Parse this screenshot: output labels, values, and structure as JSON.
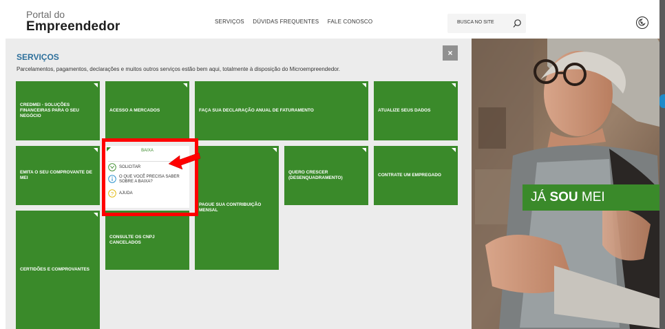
{
  "header": {
    "logo_line1": "Portal do",
    "logo_line2": "Empreendedor",
    "nav": [
      "SERVIÇOS",
      "DÚVIDAS FREQUENTES",
      "FALE CONOSCO"
    ],
    "search_placeholder": "BUSCA NO SITE"
  },
  "services": {
    "title": "SERVIÇOS",
    "subtitle": "Parcelamentos, pagamentos, declarações e muitos outros serviços estão bem aqui, totalmente à disposição do Microempreendedor.",
    "close_label": "×",
    "tiles": [
      "CREDMEI - SOLUÇÕES FINANCEIRAS PARA O SEU NEGÓCIO",
      "ACESSO A MERCADOS",
      "FAÇA SUA DECLARAÇÃO ANUAL DE FATURAMENTO",
      "ATUALIZE SEUS DADOS",
      "EMITA O SEU COMPROVANTE DE MEI",
      "PAGUE SUA CONTRIBUIÇÃO MENSAL",
      "QUERO CRESCER (DESENQUADRAMENTO)",
      "CONTRATE UM EMPREGADO",
      "CERTIDÕES E COMPROVANTES",
      "CONSULTE OS CNPJ CANCELADOS"
    ]
  },
  "popup": {
    "title": "BAIXA",
    "items": [
      {
        "label": "SOLICITAR",
        "icon": "hands-icon"
      },
      {
        "label": "O QUE VOCÊ PRECISA SABER SOBRE A BAIXA?",
        "icon": "info-icon"
      },
      {
        "label": "AJUDA",
        "icon": "help-icon"
      }
    ]
  },
  "banner": {
    "pre": "JÁ ",
    "bold": "SOU",
    "post": " MEI"
  },
  "colors": {
    "tile_green": "#3a8a2a",
    "title_blue": "#2c6f9b",
    "highlight_red": "#ff0000"
  }
}
